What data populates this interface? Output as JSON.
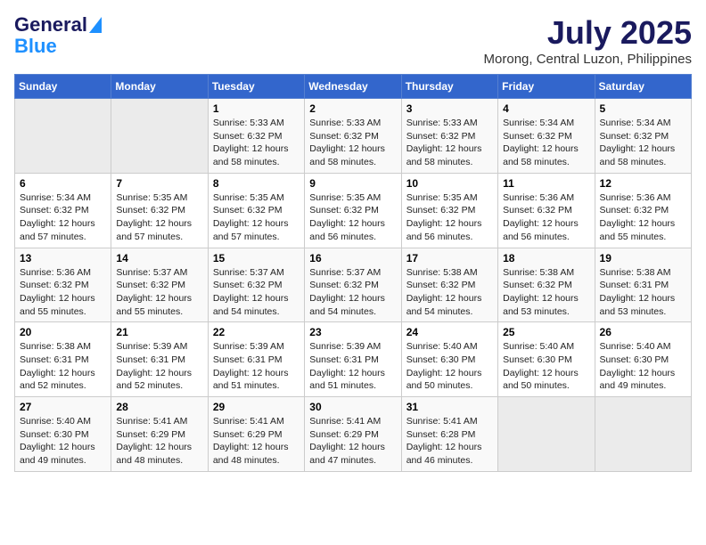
{
  "header": {
    "logo_line1": "General",
    "logo_line2": "Blue",
    "title": "July 2025",
    "subtitle": "Morong, Central Luzon, Philippines"
  },
  "weekdays": [
    "Sunday",
    "Monday",
    "Tuesday",
    "Wednesday",
    "Thursday",
    "Friday",
    "Saturday"
  ],
  "weeks": [
    [
      {
        "day": "",
        "info": ""
      },
      {
        "day": "",
        "info": ""
      },
      {
        "day": "1",
        "info": "Sunrise: 5:33 AM\nSunset: 6:32 PM\nDaylight: 12 hours and 58 minutes."
      },
      {
        "day": "2",
        "info": "Sunrise: 5:33 AM\nSunset: 6:32 PM\nDaylight: 12 hours and 58 minutes."
      },
      {
        "day": "3",
        "info": "Sunrise: 5:33 AM\nSunset: 6:32 PM\nDaylight: 12 hours and 58 minutes."
      },
      {
        "day": "4",
        "info": "Sunrise: 5:34 AM\nSunset: 6:32 PM\nDaylight: 12 hours and 58 minutes."
      },
      {
        "day": "5",
        "info": "Sunrise: 5:34 AM\nSunset: 6:32 PM\nDaylight: 12 hours and 58 minutes."
      }
    ],
    [
      {
        "day": "6",
        "info": "Sunrise: 5:34 AM\nSunset: 6:32 PM\nDaylight: 12 hours and 57 minutes."
      },
      {
        "day": "7",
        "info": "Sunrise: 5:35 AM\nSunset: 6:32 PM\nDaylight: 12 hours and 57 minutes."
      },
      {
        "day": "8",
        "info": "Sunrise: 5:35 AM\nSunset: 6:32 PM\nDaylight: 12 hours and 57 minutes."
      },
      {
        "day": "9",
        "info": "Sunrise: 5:35 AM\nSunset: 6:32 PM\nDaylight: 12 hours and 56 minutes."
      },
      {
        "day": "10",
        "info": "Sunrise: 5:35 AM\nSunset: 6:32 PM\nDaylight: 12 hours and 56 minutes."
      },
      {
        "day": "11",
        "info": "Sunrise: 5:36 AM\nSunset: 6:32 PM\nDaylight: 12 hours and 56 minutes."
      },
      {
        "day": "12",
        "info": "Sunrise: 5:36 AM\nSunset: 6:32 PM\nDaylight: 12 hours and 55 minutes."
      }
    ],
    [
      {
        "day": "13",
        "info": "Sunrise: 5:36 AM\nSunset: 6:32 PM\nDaylight: 12 hours and 55 minutes."
      },
      {
        "day": "14",
        "info": "Sunrise: 5:37 AM\nSunset: 6:32 PM\nDaylight: 12 hours and 55 minutes."
      },
      {
        "day": "15",
        "info": "Sunrise: 5:37 AM\nSunset: 6:32 PM\nDaylight: 12 hours and 54 minutes."
      },
      {
        "day": "16",
        "info": "Sunrise: 5:37 AM\nSunset: 6:32 PM\nDaylight: 12 hours and 54 minutes."
      },
      {
        "day": "17",
        "info": "Sunrise: 5:38 AM\nSunset: 6:32 PM\nDaylight: 12 hours and 54 minutes."
      },
      {
        "day": "18",
        "info": "Sunrise: 5:38 AM\nSunset: 6:32 PM\nDaylight: 12 hours and 53 minutes."
      },
      {
        "day": "19",
        "info": "Sunrise: 5:38 AM\nSunset: 6:31 PM\nDaylight: 12 hours and 53 minutes."
      }
    ],
    [
      {
        "day": "20",
        "info": "Sunrise: 5:38 AM\nSunset: 6:31 PM\nDaylight: 12 hours and 52 minutes."
      },
      {
        "day": "21",
        "info": "Sunrise: 5:39 AM\nSunset: 6:31 PM\nDaylight: 12 hours and 52 minutes."
      },
      {
        "day": "22",
        "info": "Sunrise: 5:39 AM\nSunset: 6:31 PM\nDaylight: 12 hours and 51 minutes."
      },
      {
        "day": "23",
        "info": "Sunrise: 5:39 AM\nSunset: 6:31 PM\nDaylight: 12 hours and 51 minutes."
      },
      {
        "day": "24",
        "info": "Sunrise: 5:40 AM\nSunset: 6:30 PM\nDaylight: 12 hours and 50 minutes."
      },
      {
        "day": "25",
        "info": "Sunrise: 5:40 AM\nSunset: 6:30 PM\nDaylight: 12 hours and 50 minutes."
      },
      {
        "day": "26",
        "info": "Sunrise: 5:40 AM\nSunset: 6:30 PM\nDaylight: 12 hours and 49 minutes."
      }
    ],
    [
      {
        "day": "27",
        "info": "Sunrise: 5:40 AM\nSunset: 6:30 PM\nDaylight: 12 hours and 49 minutes."
      },
      {
        "day": "28",
        "info": "Sunrise: 5:41 AM\nSunset: 6:29 PM\nDaylight: 12 hours and 48 minutes."
      },
      {
        "day": "29",
        "info": "Sunrise: 5:41 AM\nSunset: 6:29 PM\nDaylight: 12 hours and 48 minutes."
      },
      {
        "day": "30",
        "info": "Sunrise: 5:41 AM\nSunset: 6:29 PM\nDaylight: 12 hours and 47 minutes."
      },
      {
        "day": "31",
        "info": "Sunrise: 5:41 AM\nSunset: 6:28 PM\nDaylight: 12 hours and 46 minutes."
      },
      {
        "day": "",
        "info": ""
      },
      {
        "day": "",
        "info": ""
      }
    ]
  ]
}
